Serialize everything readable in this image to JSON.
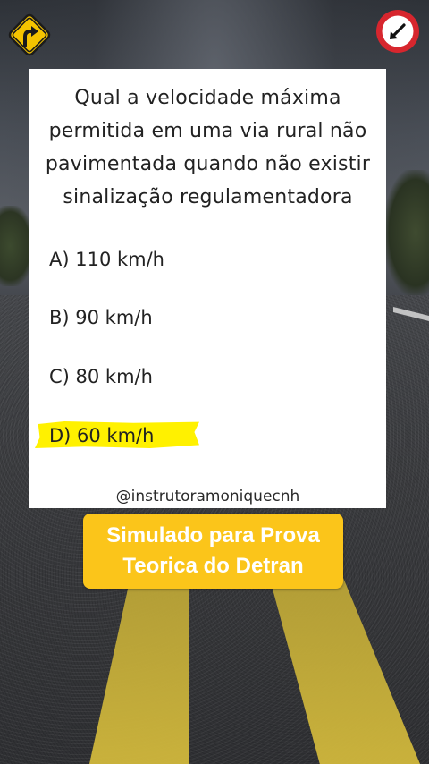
{
  "question": {
    "text": "Qual a velocidade máxima permitida em uma via rural não pavimentada quando não existir sinalização regulamentadora",
    "lines": [
      "Qual a velocidade máxima",
      "permitida em uma via rural não",
      "pavimentada quando não existir",
      "sinalização regulamentadora"
    ]
  },
  "options": [
    {
      "label": "A) 110 km/h"
    },
    {
      "label": "B) 90 km/h"
    },
    {
      "label": "C) 80 km/h"
    },
    {
      "label": "D) 60 km/h",
      "highlighted": true
    }
  ],
  "handle": "@instrutoramoniquecnh",
  "banner": {
    "line1": "Simulado para Prova",
    "line2": "Teorica do Detran"
  },
  "icons": {
    "top_left": "curve-right-warning-sign-icon",
    "top_right": "no-turn-arrow-prohibition-sign-icon"
  },
  "colors": {
    "banner": "#fbc51a",
    "highlight": "#fff100",
    "warning_sign": "#f5c400",
    "prohibition_ring": "#d7262e"
  }
}
